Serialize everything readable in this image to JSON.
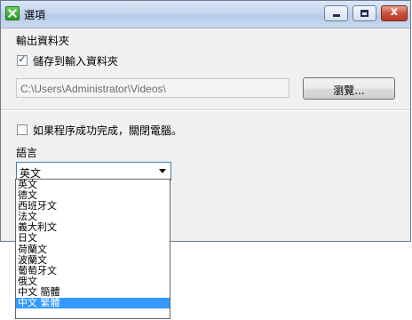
{
  "window": {
    "title": "選項",
    "colors": {
      "titlebar": "#c4d6ee",
      "close": "#c9523b",
      "selection": "#3399ff"
    }
  },
  "titlebar_buttons": {
    "minimize": "minimize-icon",
    "maximize": "maximize-icon",
    "close_glyph": "x"
  },
  "output": {
    "section_label": "輸出資料夾",
    "save_to_input_label": "儲存到輸入資料夾",
    "save_to_input_checked": true,
    "path_value": "C:\\Users\\Administrator\\Videos\\",
    "browse_label": "瀏覽..."
  },
  "shutdown": {
    "label": "如果程序成功完成，關閉電腦。",
    "checked": false
  },
  "language": {
    "label": "語言",
    "selected": "英文",
    "options": [
      "英文",
      "德文",
      "西班牙文",
      "法文",
      "義大利文",
      "日文",
      "荷蘭文",
      "波蘭文",
      "葡萄牙文",
      "俄文",
      "中文 簡體",
      "中文 繁體"
    ],
    "highlighted_index": 11
  }
}
